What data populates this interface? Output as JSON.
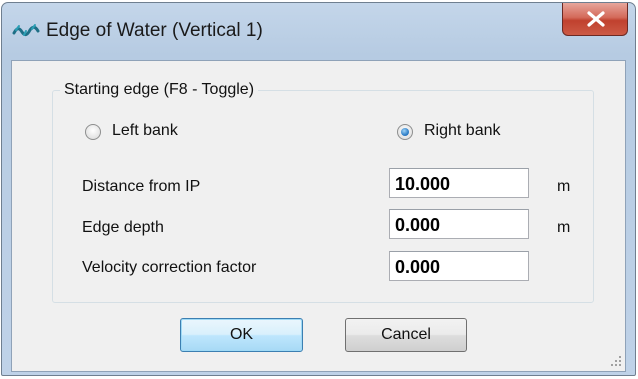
{
  "window": {
    "title": "Edge of Water (Vertical 1)",
    "icon": "wave-app-icon",
    "close_icon": "close-icon"
  },
  "group": {
    "legend": "Starting edge (F8 - Toggle)",
    "radios": [
      {
        "label": "Left bank",
        "checked": false
      },
      {
        "label": "Right bank",
        "checked": true
      }
    ]
  },
  "fields": {
    "distance": {
      "label": "Distance from IP",
      "value": "10.000",
      "unit": "m"
    },
    "edge_depth": {
      "label": "Edge depth",
      "value": "0.000",
      "unit": "m"
    },
    "velocity": {
      "label": "Velocity correction factor",
      "value": "0.000",
      "unit": ""
    }
  },
  "buttons": {
    "ok": "OK",
    "cancel": "Cancel"
  },
  "colors": {
    "accent": "#3c7fb1",
    "close": "#c0412e",
    "frame": "#bfd2e8"
  }
}
